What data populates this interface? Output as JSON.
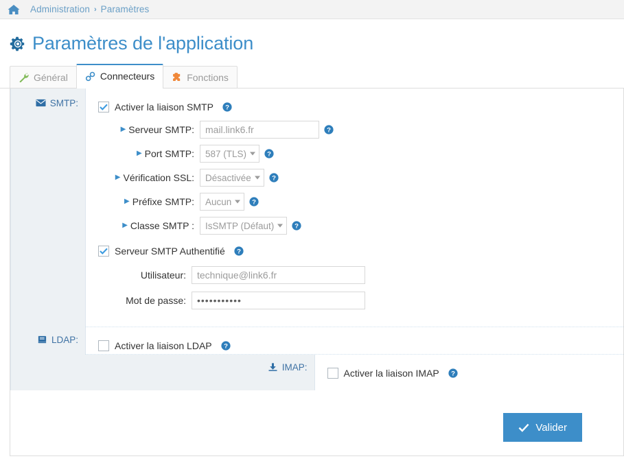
{
  "breadcrumb": {
    "home_icon": "home-icon",
    "items": [
      {
        "label": "Administration"
      },
      {
        "label": "Paramètres"
      }
    ],
    "separator": "›"
  },
  "header": {
    "icon": "gear-icon",
    "title": "Paramètres de l'application"
  },
  "tabs": [
    {
      "label": "Général",
      "icon": "wrench-icon",
      "active": false,
      "icon_color": "#82bb5a"
    },
    {
      "label": "Connecteurs",
      "icon": "link-icon",
      "active": true,
      "icon_color": "#3d8ec9"
    },
    {
      "label": "Fonctions",
      "icon": "puzzle-icon",
      "active": false,
      "icon_color": "#f0883a"
    }
  ],
  "sections": {
    "smtp": {
      "label": "SMTP:",
      "icon": "envelope-icon",
      "enable_checkbox": {
        "label": "Activer la liaison SMTP",
        "checked": true,
        "help": "help-icon"
      },
      "fields": {
        "server": {
          "label": "Serveur SMTP:",
          "value": "mail.link6.fr",
          "help": "help-icon"
        },
        "port": {
          "label": "Port SMTP:",
          "value": "587 (TLS)",
          "help": "help-icon"
        },
        "ssl": {
          "label": "Vérification SSL:",
          "value": "Désactivée",
          "help": "help-icon"
        },
        "prefix": {
          "label": "Préfixe SMTP:",
          "value": "Aucun",
          "help": "help-icon"
        },
        "class": {
          "label": "Classe SMTP :",
          "value": "IsSMTP (Défaut)",
          "help": "help-icon"
        }
      },
      "auth_checkbox": {
        "label": "Serveur SMTP Authentifié",
        "checked": true,
        "help": "help-icon"
      },
      "auth_fields": {
        "user": {
          "label": "Utilisateur:",
          "value": "technique@link6.fr"
        },
        "password": {
          "label": "Mot de passe:",
          "value": "•••••••••••"
        }
      }
    },
    "ldap": {
      "label": "LDAP:",
      "icon": "book-icon",
      "enable_checkbox": {
        "label": "Activer la liaison LDAP",
        "checked": false,
        "help": "help-icon"
      }
    },
    "imap": {
      "label": "IMAP:",
      "icon": "download-icon",
      "enable_checkbox": {
        "label": "Activer la liaison IMAP",
        "checked": false,
        "help": "help-icon"
      }
    }
  },
  "footer": {
    "submit": {
      "label": "Valider",
      "icon": "check-icon"
    }
  },
  "colors": {
    "accent": "#3d8ec9",
    "breadcrumb_link": "#6a9fc6",
    "section_bg": "#edf1f4",
    "border": "#dddddd"
  }
}
